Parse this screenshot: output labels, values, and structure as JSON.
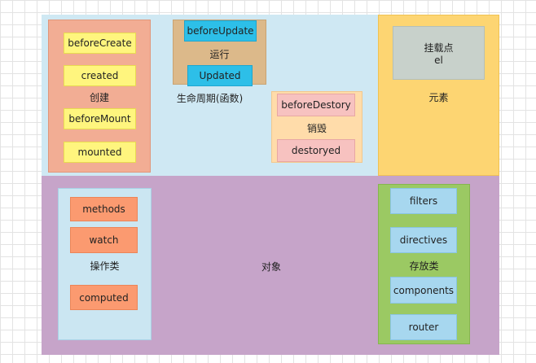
{
  "lifecycle": {
    "title": "生命周期(函数)",
    "create": {
      "label": "创建",
      "hooks": [
        "beforeCreate",
        "created",
        "beforeMount",
        "mounted"
      ]
    },
    "run": {
      "label": "运行",
      "hooks": [
        "beforeUpdate",
        "Updated"
      ]
    },
    "destroy": {
      "label": "销毁",
      "hooks": [
        "beforeDestory",
        "destoryed"
      ]
    }
  },
  "element": {
    "label": "元素",
    "mount": {
      "line1": "挂载点",
      "line2": "el"
    }
  },
  "object": {
    "label": "对象",
    "operations": {
      "label": "操作类",
      "items": [
        "methods",
        "watch",
        "computed"
      ]
    },
    "storage": {
      "label": "存放类",
      "items": [
        "filters",
        "directives",
        "components",
        "router"
      ]
    }
  },
  "colors": {
    "lifecycle_bg": "#cfe8f3",
    "create_bg": "#f2ad94",
    "run_bg": "#dcb98a",
    "destroy_bg": "#ffdcaa",
    "element_bg": "#fdd572",
    "mount_bg": "#c8d1cb",
    "object_bg": "#c6a4c9",
    "operations_bg": "#cbe6f2",
    "storage_bg": "#9bc963"
  }
}
